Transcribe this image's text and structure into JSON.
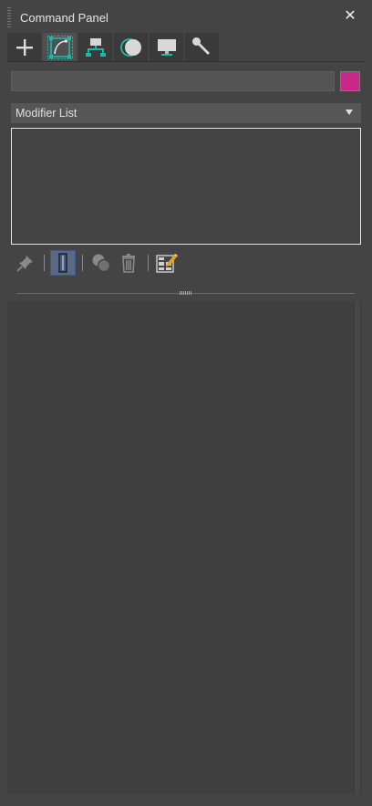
{
  "window": {
    "title": "Command Panel",
    "close_icon": "close-icon",
    "accent_color": "#1fb8a6"
  },
  "tabs": [
    {
      "id": "create",
      "icon": "plus-icon",
      "active": false
    },
    {
      "id": "modify",
      "icon": "modify-curve-icon",
      "active": true
    },
    {
      "id": "hierarchy",
      "icon": "hierarchy-icon",
      "active": false
    },
    {
      "id": "motion",
      "icon": "motion-icon",
      "active": false
    },
    {
      "id": "display",
      "icon": "display-monitor-icon",
      "active": false
    },
    {
      "id": "utilities",
      "icon": "wrench-icon",
      "active": false
    }
  ],
  "object_name": {
    "value": "",
    "placeholder": ""
  },
  "object_color": "#c8288a",
  "modifier_list": {
    "label": "Modifier List"
  },
  "modifier_stack": {
    "items": []
  },
  "stack_toolbar": [
    {
      "id": "pin-stack",
      "icon": "pin-icon",
      "active": false
    },
    {
      "id": "show-end-result",
      "icon": "show-end-result-icon",
      "active": true
    },
    {
      "id": "make-unique",
      "icon": "make-unique-icon",
      "active": false
    },
    {
      "id": "remove-modifier",
      "icon": "trash-icon",
      "active": false
    },
    {
      "id": "configure-modifier-sets",
      "icon": "configure-sets-icon",
      "active": false
    }
  ]
}
